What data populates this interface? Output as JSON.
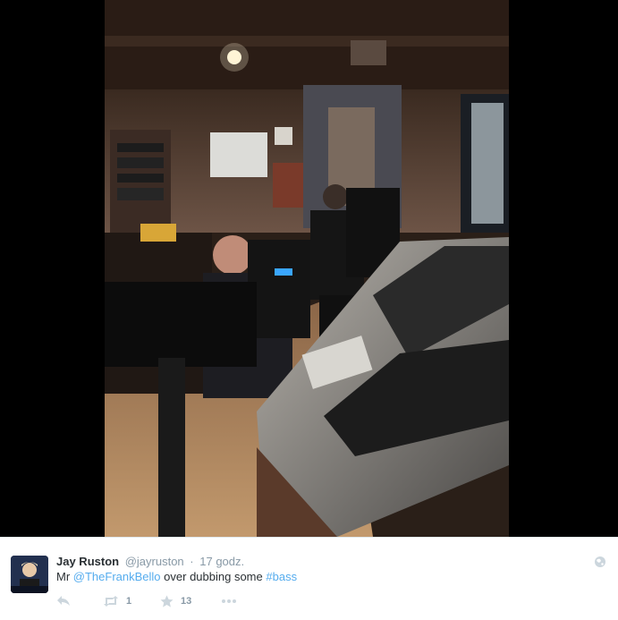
{
  "tweet": {
    "display_name": "Jay Ruston",
    "handle": "@jayruston",
    "separator": "·",
    "time": "17 godz.",
    "text_prefix": "Mr",
    "mention": "@TheFrankBello",
    "text_middle": "over dubbing some",
    "hashtag": "#bass"
  },
  "actions": {
    "reply_icon": "reply-icon",
    "retweet_icon": "retweet-icon",
    "retweet_count": "1",
    "favorite_icon": "star-icon",
    "favorite_count": "13",
    "more_icon": "more-dots-icon"
  },
  "colors": {
    "link": "#55acee",
    "meta": "#8899a6",
    "text": "#292f33",
    "media_background": "#000000"
  }
}
